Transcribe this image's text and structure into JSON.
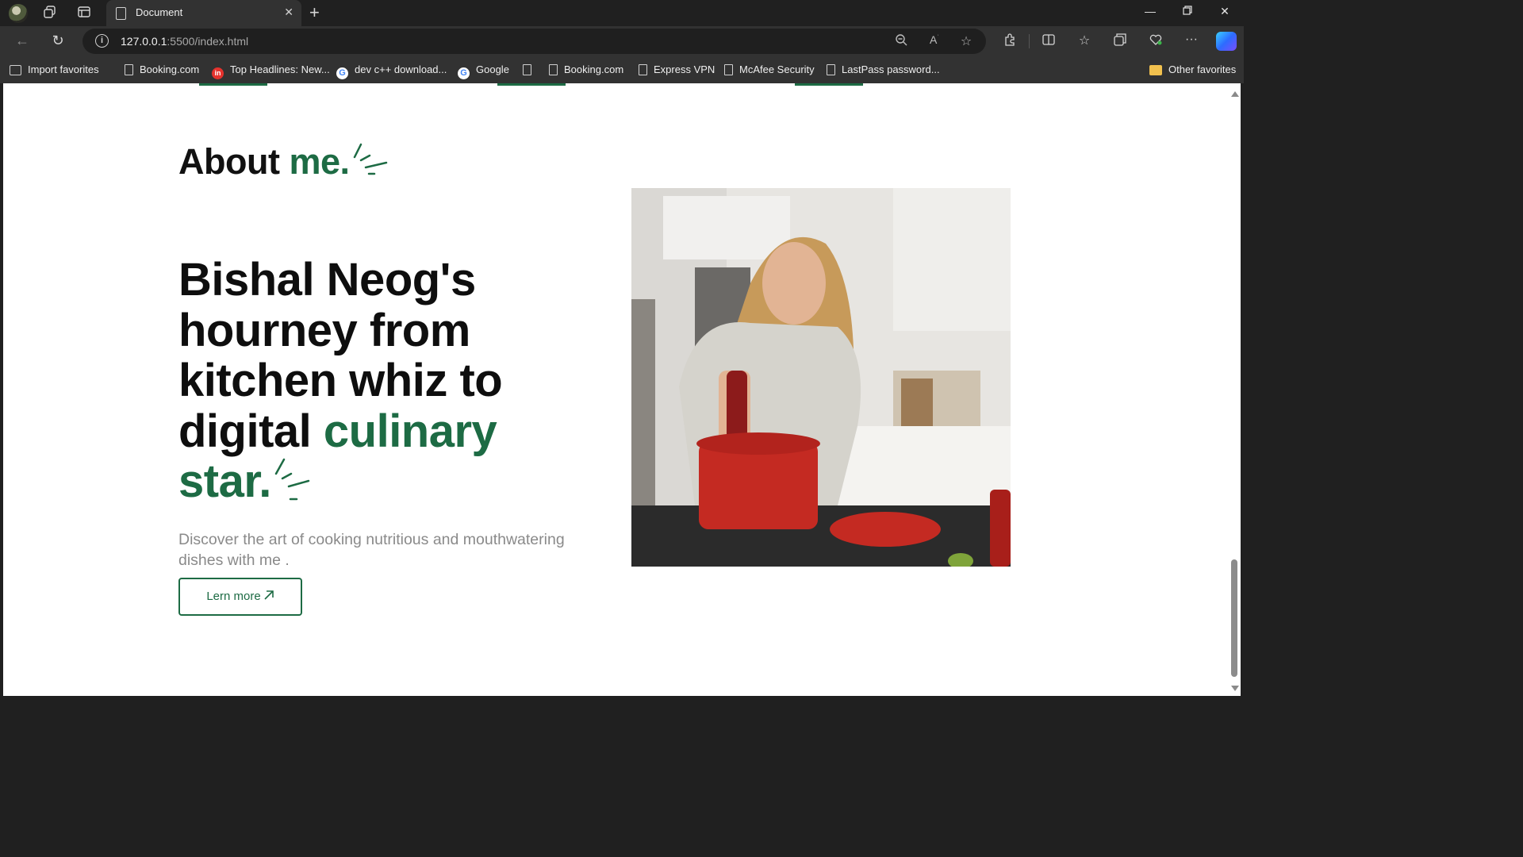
{
  "browser": {
    "tab_title": "Document",
    "url_host": "127.0.0.1",
    "url_rest": ":5500/index.html",
    "favorites": [
      {
        "label": "Import favorites",
        "icon": "import-icon"
      },
      {
        "label": "Booking.com",
        "icon": "page-icon"
      },
      {
        "label": "Top Headlines: New...",
        "icon": "inshorts-icon"
      },
      {
        "label": "dev c++ download...",
        "icon": "google-icon"
      },
      {
        "label": "Google",
        "icon": "google-icon"
      },
      {
        "label": "Booking.com",
        "icon": "page-icon"
      },
      {
        "label": "Express VPN",
        "icon": "page-icon"
      },
      {
        "label": "McAfee Security",
        "icon": "page-icon"
      },
      {
        "label": "LastPass password...",
        "icon": "page-icon"
      }
    ],
    "other_favorites": "Other favorites"
  },
  "page": {
    "about_prefix": "About ",
    "about_accent": "me.",
    "headline_part1": "Bishal Neog's hourney from kitchen whiz to digital ",
    "headline_accent": "culinary star.",
    "description": "Discover the art of cooking nutritious and mouthwatering dishes with me .",
    "cta_label": "Lern more",
    "accent_color": "#1d6b44"
  }
}
